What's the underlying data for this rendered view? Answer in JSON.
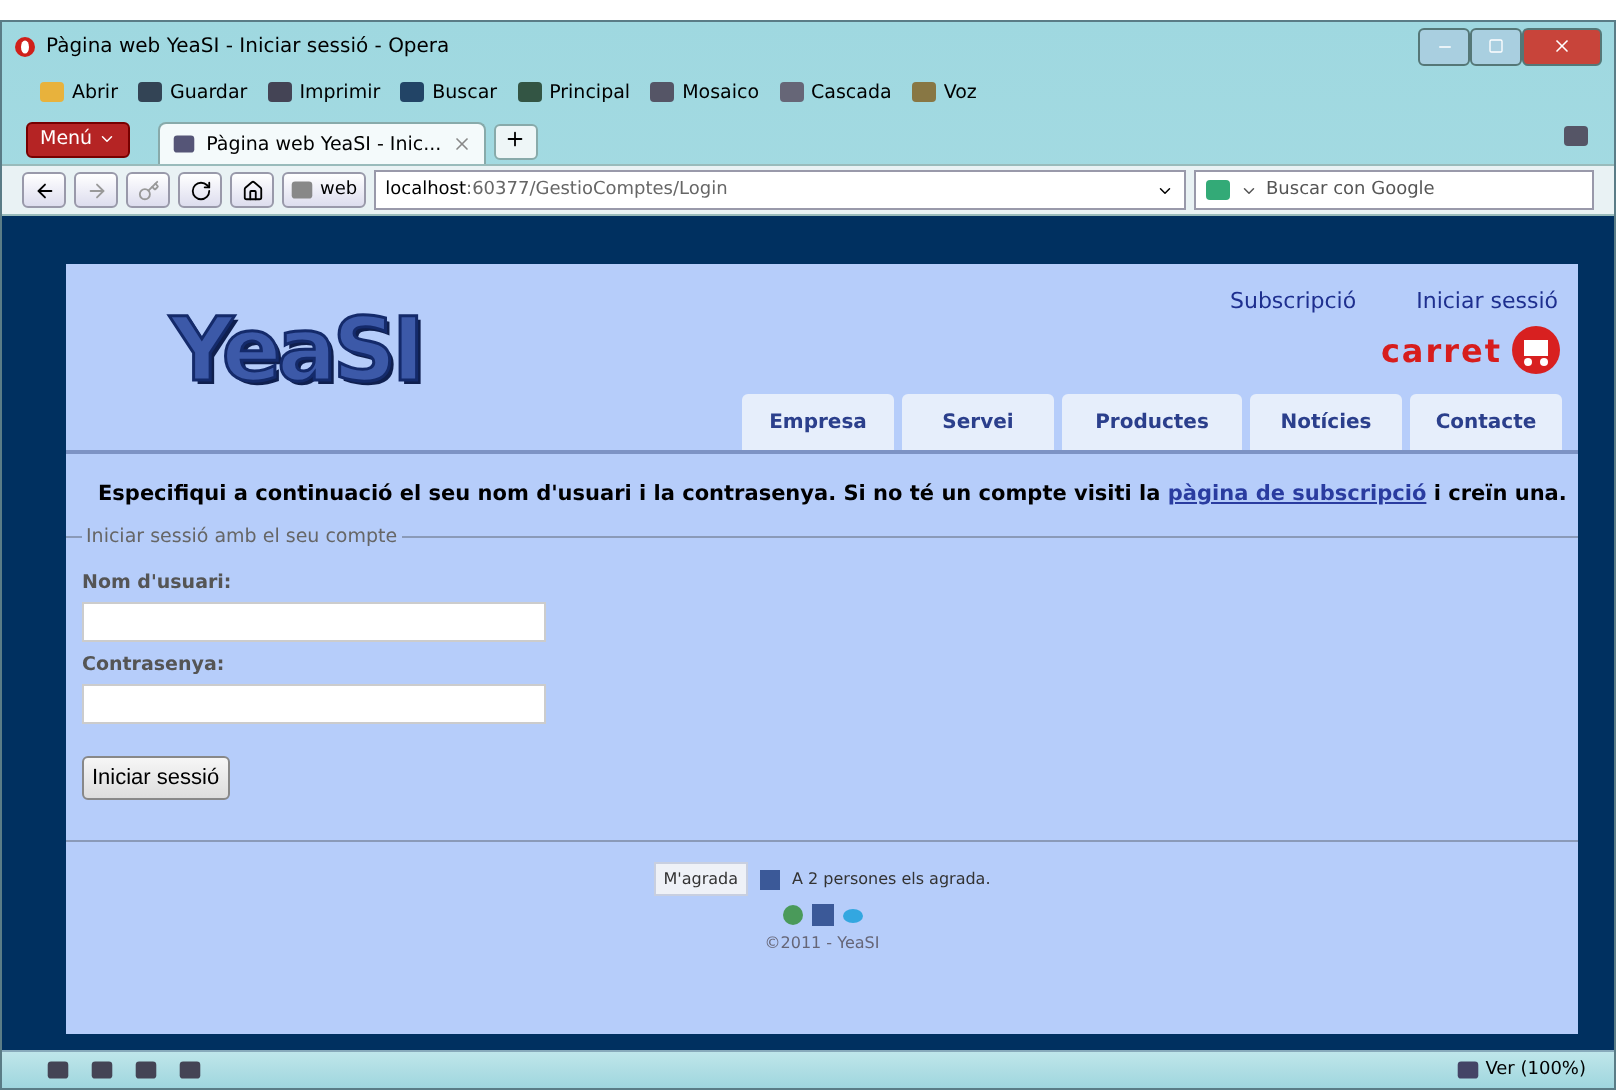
{
  "window": {
    "title": "Pàgina web YeaSI - Iniciar sessió - Opera"
  },
  "toolbar": [
    "Abrir",
    "Guardar",
    "Imprimir",
    "Buscar",
    "Principal",
    "Mosaico",
    "Cascada",
    "Voz"
  ],
  "menu_button": "Menú",
  "tabs": [
    {
      "label": "Pàgina web YeaSI - Inic...",
      "selected": true
    }
  ],
  "address_bar": {
    "label": "web",
    "host": "localhost",
    "path": ":60377/GestioComptes/Login"
  },
  "search": {
    "placeholder": "Buscar con Google"
  },
  "site": {
    "logo": "YeaSI",
    "top_links": [
      "Subscripció",
      "Iniciar sessió"
    ],
    "cart_label": "carret",
    "nav": [
      {
        "label": "Empresa",
        "selected": false
      },
      {
        "label": "Servei",
        "selected": false
      },
      {
        "label": "Productes",
        "selected": false
      },
      {
        "label": "Notícies",
        "selected": false
      },
      {
        "label": "Contacte",
        "selected": false
      }
    ],
    "intro": {
      "before": "Especifiqui a continuació el seu nom d'usuari i la contrasenya. Si no té un compte visiti la",
      "link": "pàgina de subscripció",
      "after": "i creïn una."
    },
    "login": {
      "legend": "Iniciar sessió amb el seu compte",
      "fields": [
        {
          "label": "Nom d'usuari:"
        },
        {
          "label": "Contrasenya:"
        }
      ],
      "button": "Iniciar sessió"
    },
    "footer": {
      "like_button": "M'agrada",
      "like_text": "A 2 persones els agrada.",
      "copyright": "©2011 - YeaSI"
    }
  },
  "status_bar": {
    "zoom": "Ver (100%)"
  }
}
